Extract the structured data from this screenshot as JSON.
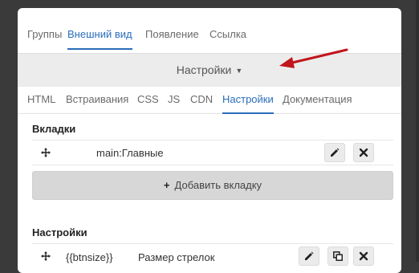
{
  "top_tabs": [
    {
      "label": "Группы",
      "active": false
    },
    {
      "label": "Внешний вид",
      "active": true
    },
    {
      "label": "Появление",
      "active": false
    },
    {
      "label": "Ссылка",
      "active": false
    }
  ],
  "settings_dropdown": {
    "label": "Настройки"
  },
  "sub_tabs": [
    {
      "label": "HTML",
      "active": false
    },
    {
      "label": "Встраивания",
      "active": false
    },
    {
      "label": "CSS",
      "active": false
    },
    {
      "label": "JS",
      "active": false
    },
    {
      "label": "CDN",
      "active": false
    },
    {
      "label": "Настройки",
      "active": true
    },
    {
      "label": "Документация",
      "active": false
    }
  ],
  "tabs_section": {
    "title": "Вкладки",
    "rows": [
      {
        "value": "main:Главные"
      }
    ],
    "add_button_label": "Добавить вкладку"
  },
  "settings_section": {
    "title": "Настройки",
    "rows": [
      {
        "key": "{{btnsize}}",
        "label": "Размер стрелок"
      }
    ]
  },
  "colors": {
    "accent": "#2a6ebb",
    "arrow": "#c0161c"
  }
}
